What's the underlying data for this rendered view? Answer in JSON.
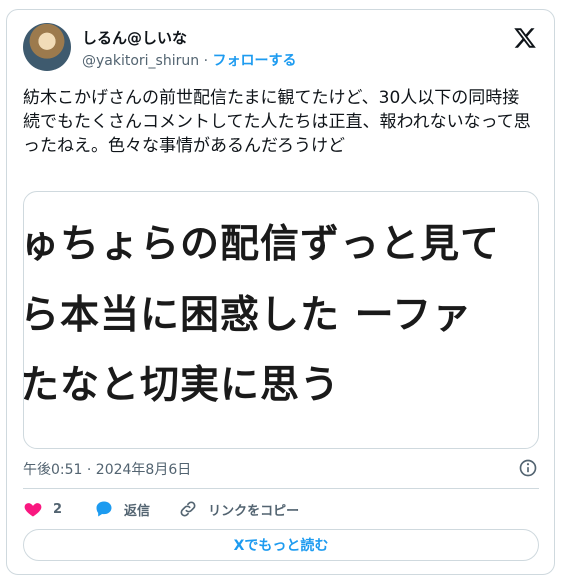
{
  "author": {
    "display_name": "しるん@しいな",
    "handle": "@yakitori_shirun",
    "separator": "·",
    "follow_label": "フォローする"
  },
  "tweet": {
    "text": "紡木こかげさんの前世配信たまに観てたけど、30人以下の同時接続でもたくさんコメントしてた人たちは正直、報われないなって思ったねえ。色々な事情があるんだろうけど"
  },
  "media": {
    "lines": [
      "ゅちょらの配信ずっと見て",
      "ら本当に困惑した ーファ",
      "たなと切実に思う"
    ]
  },
  "meta": {
    "timestamp": "午後0:51 · 2024年8月6日"
  },
  "actions": {
    "like_count": "2",
    "reply_label": "返信",
    "copy_link_label": "リンクをコピー"
  },
  "read_more_label": "Xでもっと読む",
  "colors": {
    "accent": "#1d9bf0",
    "like": "#f91880",
    "border": "#cfd9de",
    "muted": "#536471"
  }
}
